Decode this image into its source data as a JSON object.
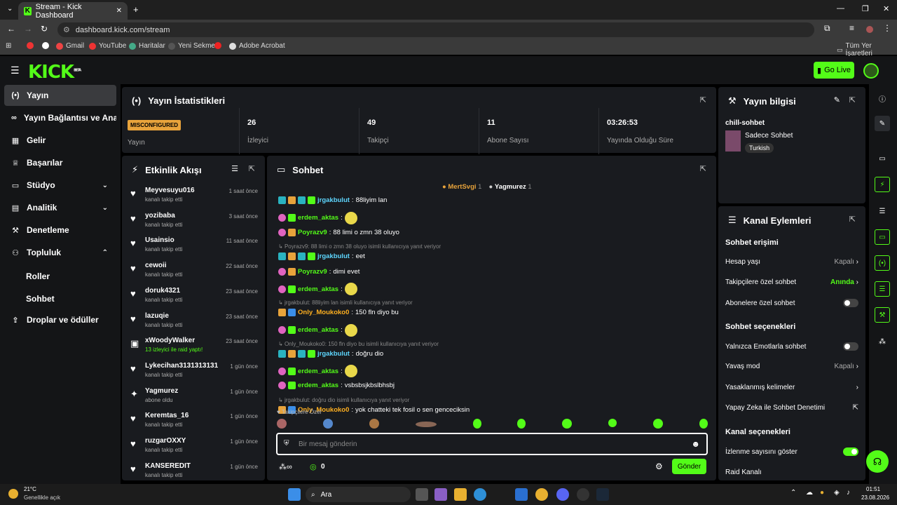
{
  "browser": {
    "tab_title": "Stream - Kick Dashboard",
    "url": "dashboard.kick.com/stream",
    "bookmarks": [
      "Gmail",
      "YouTube",
      "Haritalar",
      "Yeni Sekme",
      "Adobe Acrobat"
    ],
    "all_bookmarks": "Tüm Yer İşaretleri"
  },
  "header": {
    "logo": "KICK",
    "logo_sup": "BETA",
    "golive": "Go Live"
  },
  "sidebar": {
    "items": [
      "Yayın",
      "Yayın Bağlantısı ve Anahtarı",
      "Gelir",
      "Başarılar",
      "Stüdyo",
      "Analitik",
      "Denetleme",
      "Topluluk"
    ],
    "sub": [
      "Roller",
      "Sohbet"
    ],
    "drops": "Droplar ve ödüller"
  },
  "stats": {
    "title": "Yayın İstatistikleri",
    "badge": "MISCONFIGURED",
    "badge_label": "Yayın",
    "items": [
      {
        "v": "26",
        "l": "İzleyici"
      },
      {
        "v": "49",
        "l": "Takipçi"
      },
      {
        "v": "11",
        "l": "Abone Sayısı"
      },
      {
        "v": "03:26:53",
        "l": "Yayında Olduğu Süre"
      }
    ]
  },
  "activity": {
    "title": "Etkinlik Akışı",
    "items": [
      {
        "u": "Meyvesuyu016",
        "t": "kanalı takip etti",
        "tm": "1 saat önce"
      },
      {
        "u": "yozibaba",
        "t": "kanalı takip etti",
        "tm": "3 saat önce"
      },
      {
        "u": "Usainsio",
        "t": "kanalı takip etti",
        "tm": "11 saat önce"
      },
      {
        "u": "cewoii",
        "t": "kanalı takip etti",
        "tm": "22 saat önce"
      },
      {
        "u": "doruk4321",
        "t": "kanalı takip etti",
        "tm": "23 saat önce"
      },
      {
        "u": "lazuqie",
        "t": "kanalı takip etti",
        "tm": "23 saat önce"
      },
      {
        "u": "xWoodyWalker",
        "t": "13 izleyici ile raid yaptı!",
        "tm": "23 saat önce"
      },
      {
        "u": "Lykecihan3131313131",
        "t": "kanalı takip etti",
        "tm": "1 gün önce"
      },
      {
        "u": "Yagmurez",
        "t": "abone oldu",
        "tm": "1 gün önce"
      },
      {
        "u": "Keremtas_16",
        "t": "kanalı takip etti",
        "tm": "1 gün önce"
      },
      {
        "u": "ruzgarOXXY",
        "t": "kanalı takip etti",
        "tm": "1 gün önce"
      },
      {
        "u": "KANSEREDIT",
        "t": "kanalı takip etti",
        "tm": "1 gün önce"
      }
    ]
  },
  "chat": {
    "title": "Sohbet",
    "top": [
      {
        "n": "MertSvgi",
        "c": "1"
      },
      {
        "n": "Yagmurez",
        "c": "1"
      }
    ],
    "lines": [
      {
        "n": "jrgakbulut",
        "c": "b",
        "m": "88liyim lan"
      },
      {
        "n": "erdem_aktas",
        "c": "g",
        "m": ""
      },
      {
        "n": "Poyrazv9",
        "c": "g",
        "m": "88 limi o zmn 38 oluyo"
      },
      {
        "r": "Poyrazv9: 88 limi o zmn 38 oluyo isimli kullanıcıya yanıt veriyor"
      },
      {
        "n": "jrgakbulut",
        "c": "b",
        "m": "eet"
      },
      {
        "n": "Poyrazv9",
        "c": "g",
        "m": "dimi evet"
      },
      {
        "n": "erdem_aktas",
        "c": "g",
        "m": ""
      },
      {
        "r": "jrgakbulut: 88liyim lan isimli kullanıcıya yanıt veriyor"
      },
      {
        "n": "Only_Moukoko0",
        "c": "o",
        "m": "150 fln diyo bu"
      },
      {
        "n": "erdem_aktas",
        "c": "g",
        "m": ""
      },
      {
        "r": "Only_Moukoko0: 150 fln diyo bu isimli kullanıcıya yanıt veriyor"
      },
      {
        "n": "jrgakbulut",
        "c": "b",
        "m": "doğru dio"
      },
      {
        "n": "erdem_aktas",
        "c": "g",
        "m": ""
      },
      {
        "n": "erdem_aktas",
        "c": "g",
        "m": "vsbsbsjkbslbhsbj"
      },
      {
        "r": "jrgakbulut: doğru dio isimli kullanıcıya yanıt veriyor"
      },
      {
        "n": "Only_Moukoko0",
        "c": "o",
        "m": "yok chatteki tek fosil o sen genceciksin"
      }
    ],
    "followers_only": "Takipçilere Özel",
    "placeholder": "Bir mesaj gönderin",
    "count": "0",
    "send": "Gönder"
  },
  "info": {
    "title": "Yayın bilgisi",
    "category": "chill-sohbet",
    "stream_title": "Sadece Sohbet",
    "tag": "Turkish"
  },
  "actions": {
    "title": "Kanal Eylemleri",
    "s1": "Sohbet erişimi",
    "age": "Hesap yaşı",
    "age_v": "Kapalı",
    "follow": "Takipçilere özel sohbet",
    "follow_v": "Anında",
    "subs": "Abonelere özel sohbet",
    "s2": "Sohbet seçenekleri",
    "emote": "Yalnızca Emotlarla sohbet",
    "slow": "Yavaş mod",
    "slow_v": "Kapalı",
    "banned": "Yasaklanmış kelimeler",
    "ai": "Yapay Zeka ile Sohbet Denetimi",
    "s3": "Kanal seçenekleri",
    "viewers": "İzlenme sayısını göster",
    "raid": "Raid Kanalı"
  },
  "taskbar": {
    "temp": "21°C",
    "weather": "Genellikle açık",
    "search": "Ara",
    "time": "01:51",
    "date": "23.08.2026"
  },
  "colors": {
    "accent": "#53fc18",
    "panel": "#191b1f",
    "badge": "#e8a33b"
  }
}
